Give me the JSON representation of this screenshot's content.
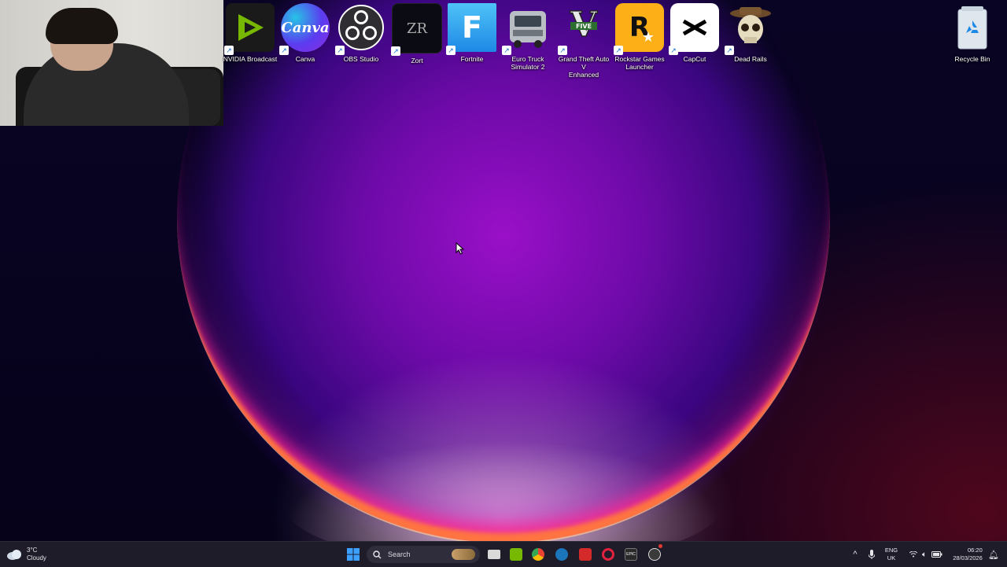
{
  "desktop_icons": [
    {
      "label": "NVIDIA Broadcast",
      "icon": "nvidia-broadcast-icon",
      "color": "#76b900"
    },
    {
      "label": "Canva",
      "icon": "canva-icon",
      "color": "#7d2ae8"
    },
    {
      "label": "OBS Studio",
      "icon": "obs-icon",
      "color": "#302e31"
    },
    {
      "label": "Zort",
      "icon": "zort-icon",
      "color": "#0b0b14"
    },
    {
      "label": "Fortnite",
      "icon": "fortnite-icon",
      "color": "#2d9be0"
    },
    {
      "label": "Euro Truck\nSimulator 2",
      "icon": "truck-icon",
      "color": "#8a8f96"
    },
    {
      "label": "Grand Theft Auto V\nEnhanced",
      "icon": "gta-icon",
      "color": "#2c3e1c"
    },
    {
      "label": "Rockstar Games\nLauncher",
      "icon": "rockstar-icon",
      "color": "#fcaf17"
    },
    {
      "label": "CapCut",
      "icon": "capcut-icon",
      "color": "#ffffff"
    },
    {
      "label": "Dead Rails",
      "icon": "skull-icon",
      "color": "#c8b890"
    }
  ],
  "recycle_bin": {
    "label": "Recycle Bin",
    "icon": "recycle-bin-icon"
  },
  "taskbar": {
    "weather": {
      "temp": "3°C",
      "condition": "Cloudy",
      "icon": "cloud-icon"
    },
    "search_placeholder": "Search",
    "apps": [
      {
        "name": "file-explorer",
        "color": "#d9d9d9"
      },
      {
        "name": "nvidia",
        "color": "#76b900"
      },
      {
        "name": "chrome",
        "color": "#ea4335"
      },
      {
        "name": "steam",
        "color": "#1b75bb"
      },
      {
        "name": "game-app",
        "color": "#d42a2a"
      },
      {
        "name": "opera-gx",
        "color": "#e0223f"
      },
      {
        "name": "epic-games",
        "color": "#2a2a2a"
      },
      {
        "name": "obs",
        "color": "#3a3a3a"
      }
    ],
    "lang": {
      "top": "ENG",
      "bottom": "UK"
    },
    "clock": {
      "time": "06:20",
      "date": "28/03/2026"
    }
  },
  "colors": {
    "taskbar_bg": "#1f1c2a",
    "accent": "#0a84ff"
  }
}
